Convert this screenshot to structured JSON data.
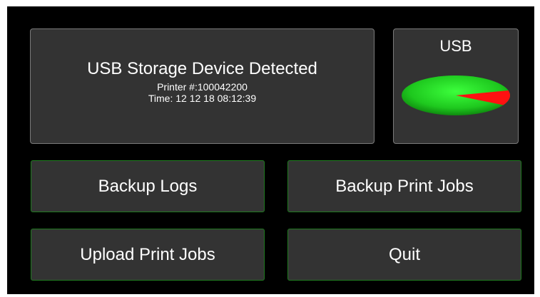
{
  "info_panel": {
    "title": "USB Storage Device Detected",
    "printer_line": "Printer #:100042200",
    "time_line": "Time: 12 12 18 08:12:39"
  },
  "usb_status": {
    "label": "USB",
    "used_fraction": 0.12,
    "free_color": "#22cc22",
    "used_color": "#ff1111"
  },
  "buttons": {
    "backup_logs": "Backup Logs",
    "backup_print_jobs": "Backup Print Jobs",
    "upload_print_jobs": "Upload Print Jobs",
    "quit": "Quit"
  },
  "colors": {
    "screen_background": "#000000",
    "panel_background": "#333333",
    "button_border": "#1f7a1f"
  }
}
